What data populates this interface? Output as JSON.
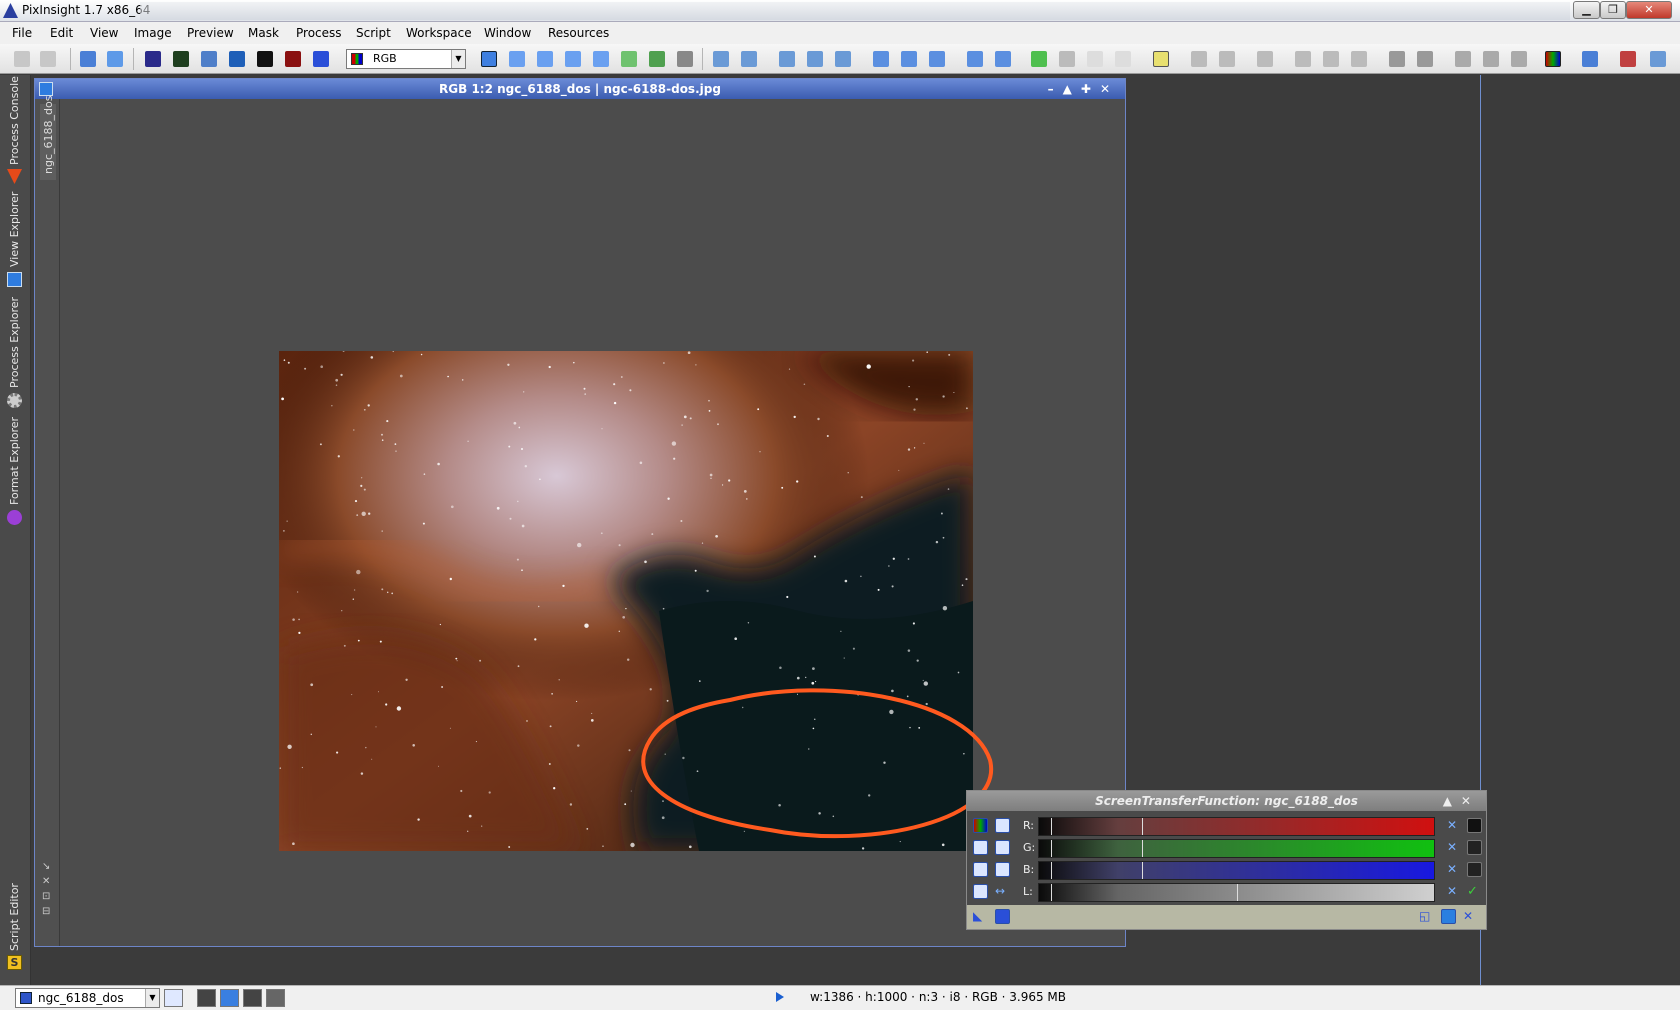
{
  "window": {
    "title": "PixInsight 1.7 x86_64"
  },
  "menu": [
    "File",
    "Edit",
    "View",
    "Image",
    "Preview",
    "Mask",
    "Process",
    "Script",
    "Workspace",
    "Window",
    "Resources"
  ],
  "toolbar": {
    "color_mode": "RGB"
  },
  "left_dock": {
    "tabs": [
      "Process Console",
      "View Explorer",
      "Process Explorer",
      "Format Explorer",
      "Script Editor"
    ]
  },
  "image_window": {
    "title": "RGB 1:2 ngc_6188_dos | ngc-6188-dos.jpg",
    "view_id": "ngc_6188_dos"
  },
  "stf": {
    "title": "ScreenTransferFunction: ngc_6188_dos",
    "channels": [
      {
        "label": "R:",
        "color": "#d01010"
      },
      {
        "label": "G:",
        "color": "#10c010"
      },
      {
        "label": "B:",
        "color": "#1818e0"
      },
      {
        "label": "L:",
        "color": "#d0d0d0"
      }
    ]
  },
  "status": {
    "view": "ngc_6188_dos",
    "info": "w:1386 · h:1000 · n:3 · i8 · RGB · 3.965 MB"
  },
  "annotation": {
    "color": "#ff5a1f"
  }
}
